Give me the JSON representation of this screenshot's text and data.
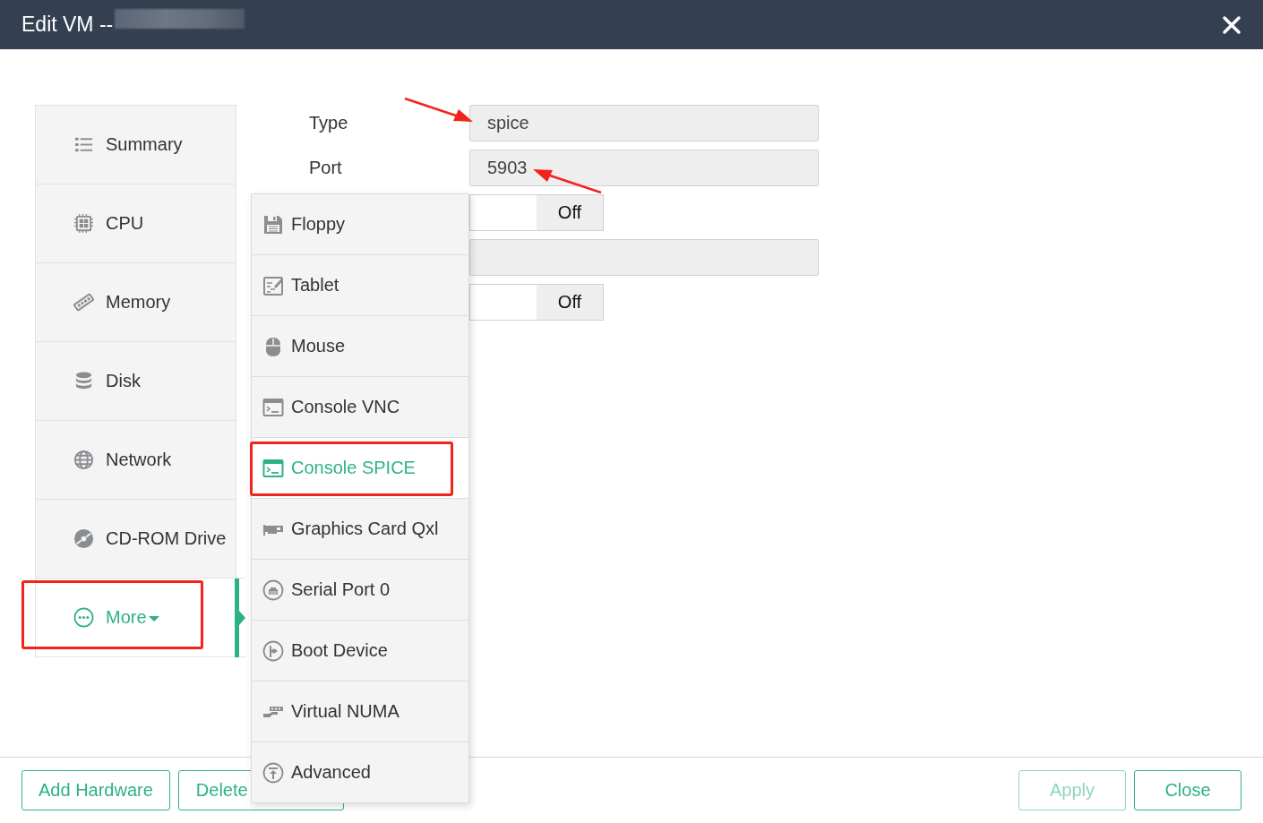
{
  "window": {
    "title": "Edit VM --",
    "title_redacted": true
  },
  "sidebar": {
    "items": [
      {
        "label": "Summary",
        "selected": false,
        "highlighted": false,
        "dropdown": false
      },
      {
        "label": "CPU",
        "selected": false,
        "highlighted": false,
        "dropdown": false
      },
      {
        "label": "Memory",
        "selected": false,
        "highlighted": false,
        "dropdown": false
      },
      {
        "label": "Disk",
        "selected": false,
        "highlighted": false,
        "dropdown": false
      },
      {
        "label": "Network",
        "selected": false,
        "highlighted": false,
        "dropdown": false
      },
      {
        "label": "CD-ROM Drive",
        "selected": false,
        "highlighted": false,
        "dropdown": false
      },
      {
        "label": "More",
        "selected": true,
        "highlighted": true,
        "dropdown": true
      }
    ]
  },
  "form": {
    "rows": [
      {
        "kind": "field",
        "label": "Type",
        "value": "spice",
        "pointed": true
      },
      {
        "kind": "field",
        "label": "Port",
        "value": "5903",
        "pointed": true
      },
      {
        "kind": "toggle",
        "on": false,
        "text": "Off"
      },
      {
        "kind": "field",
        "pointed": false
      },
      {
        "kind": "toggle",
        "on": false,
        "text": "Off"
      }
    ]
  },
  "menu": {
    "items": [
      {
        "label": "Floppy",
        "selected": false,
        "highlighted": false
      },
      {
        "label": "Tablet",
        "selected": false,
        "highlighted": false
      },
      {
        "label": "Mouse",
        "selected": false,
        "highlighted": false
      },
      {
        "label": "Console VNC",
        "selected": false,
        "highlighted": false
      },
      {
        "label": "Console SPICE",
        "selected": true,
        "highlighted": true
      },
      {
        "label": "Graphics Card Qxl",
        "selected": false,
        "highlighted": false
      },
      {
        "label": "Serial Port 0",
        "selected": false,
        "highlighted": false
      },
      {
        "label": "Boot Device",
        "selected": false,
        "highlighted": false
      },
      {
        "label": "Virtual NUMA",
        "selected": false,
        "highlighted": false
      },
      {
        "label": "Advanced",
        "selected": false,
        "highlighted": false
      }
    ]
  },
  "footer": {
    "left_buttons": [
      {
        "label": "Add Hardware",
        "disabled": false
      },
      {
        "label": "Delete",
        "disabled": false
      }
    ],
    "right_buttons": [
      {
        "label": "Apply",
        "disabled": true
      },
      {
        "label": "Close",
        "disabled": false
      }
    ]
  }
}
